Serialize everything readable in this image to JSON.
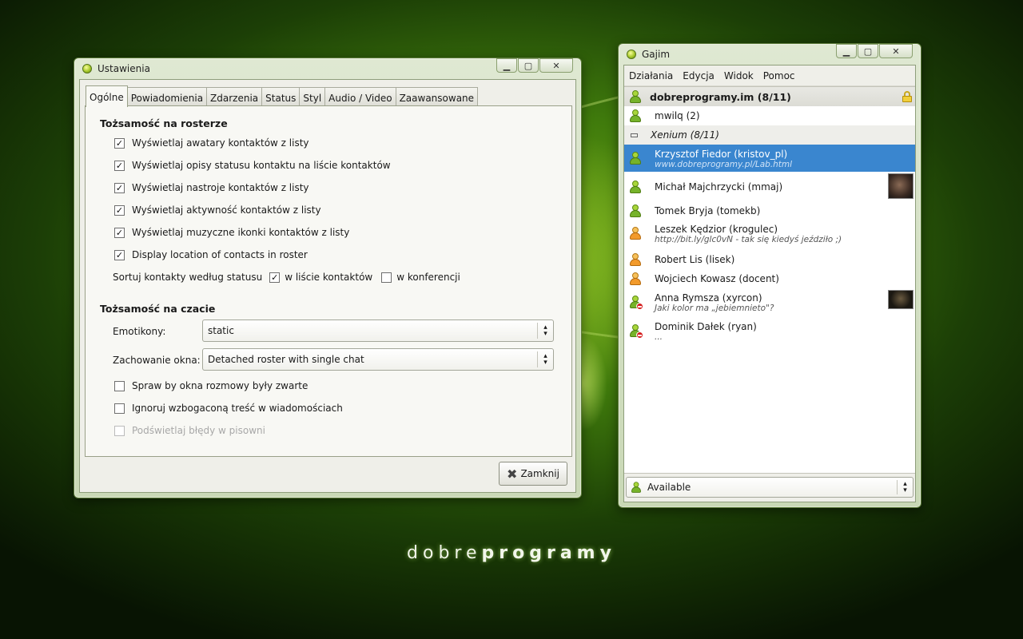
{
  "settings": {
    "title": "Ustawienia",
    "tabs": [
      "Ogólne",
      "Powiadomienia",
      "Zdarzenia",
      "Status",
      "Styl",
      "Audio / Video",
      "Zaawansowane"
    ],
    "section1_title": "Tożsamość na rosterze",
    "roster_checks": [
      {
        "label": "Wyświetlaj awatary kontaktów z listy",
        "checked": true
      },
      {
        "label": "Wyświetlaj opisy statusu kontaktu na liście kontaktów",
        "checked": true
      },
      {
        "label": "Wyświetlaj nastroje kontaktów z listy",
        "checked": true
      },
      {
        "label": "Wyświetlaj aktywność kontaktów z listy",
        "checked": true
      },
      {
        "label": "Wyświetlaj muzyczne ikonki kontaktów z listy",
        "checked": true
      },
      {
        "label": "Display location of contacts in roster",
        "checked": true
      }
    ],
    "sort_label": "Sortuj kontakty według statusu",
    "sort_in_list_label": "w liście kontaktów",
    "sort_in_conf_label": "w konferencji",
    "section2_title": "Tożsamość na czacie",
    "emoticons_label": "Emotikony:",
    "emoticons_value": "static",
    "window_behavior_label": "Zachowanie okna:",
    "window_behavior_value": "Detached roster with single chat",
    "chat_checks": [
      {
        "label": "Spraw by okna rozmowy były zwarte",
        "checked": false
      },
      {
        "label": "Ignoruj wzbogaconą treść w wiadomościach",
        "checked": false
      },
      {
        "label": "Podświetlaj błędy w pisowni",
        "checked": false,
        "disabled": true
      }
    ],
    "close_label": "Zamknij"
  },
  "gajim": {
    "title": "Gajim",
    "menu": [
      "Działania",
      "Edycja",
      "Widok",
      "Pomoc"
    ],
    "account": "dobreprogramy.im (8/11)",
    "first_contact": "mwilq (2)",
    "group": "Xenium (8/11)",
    "contacts": [
      {
        "name": "Krzysztof Fiedor (kristov_pl)",
        "status": "www.dobreprogramy.pl/Lab.html",
        "color": "green",
        "selected": true
      },
      {
        "name": "Michał Majchrzycki (mmaj)",
        "status": "",
        "color": "green",
        "avatar": "large"
      },
      {
        "name": "Tomek Bryja (tomekb)",
        "status": "",
        "color": "green"
      },
      {
        "name": "Leszek Kędzior (krogulec)",
        "status": "http://bit.ly/glc0vN - tak się kiedyś jeździło ;)",
        "color": "orange"
      },
      {
        "name": "Robert Lis (lisek)",
        "status": "",
        "color": "orange"
      },
      {
        "name": "Wojciech Kowasz (docent)",
        "status": "",
        "color": "orange"
      },
      {
        "name": "Anna Rymsza (xyrcon)",
        "status": "Jaki kolor ma „jebiemnieto\"?",
        "color": "green",
        "dnd": true,
        "avatar": "small"
      },
      {
        "name": "Dominik Dałek (ryan)",
        "status": "...",
        "color": "green",
        "dnd": true
      }
    ],
    "status_value": "Available"
  },
  "brand": {
    "part1": "dobre",
    "part2": "programy"
  },
  "colors": {
    "selection": "#3a86cf",
    "desktop": "#3f7a0c"
  }
}
